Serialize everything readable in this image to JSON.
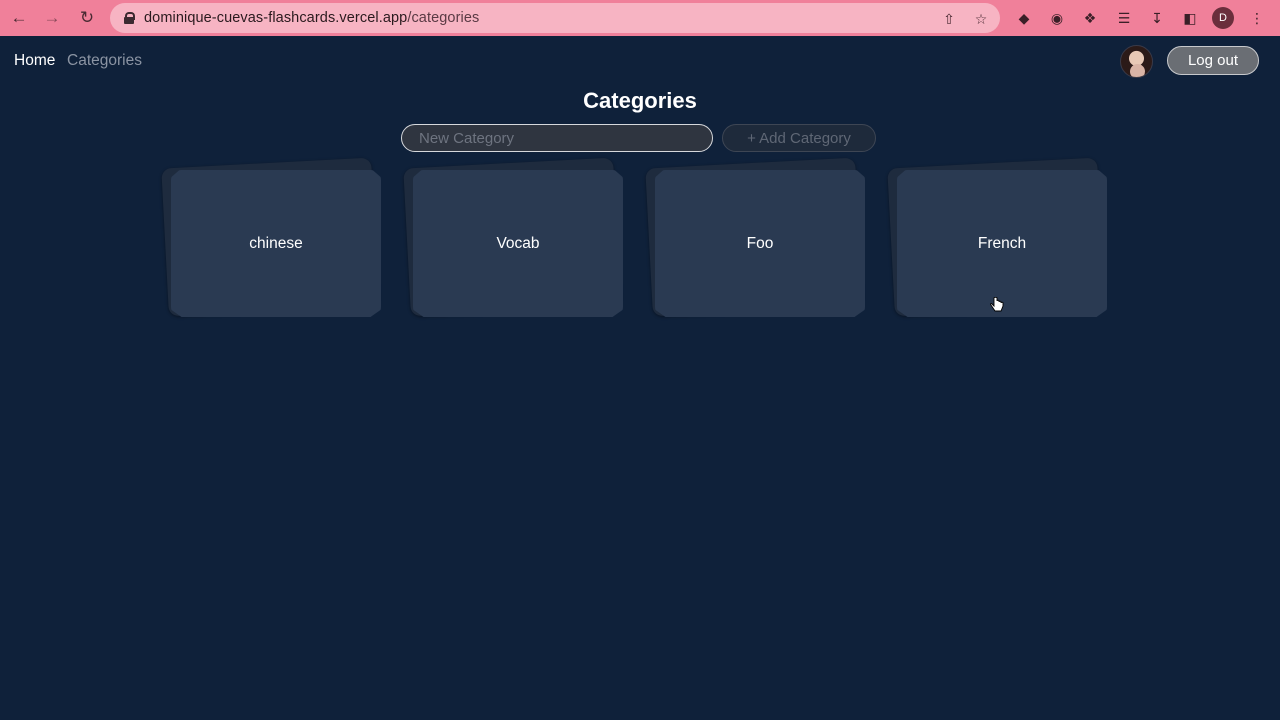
{
  "browser": {
    "url_host": "dominique-cuevas-flashcards.vercel.app",
    "url_path": "/categories",
    "profile_initial": "D",
    "chrome_color": "#f0809a"
  },
  "nav": {
    "home": "Home",
    "categories": "Categories",
    "logout": "Log out"
  },
  "page": {
    "title": "Categories",
    "input_placeholder": "New Category",
    "add_button": "+ Add Category"
  },
  "categories": [
    "chinese",
    "Vocab",
    "Foo",
    "French"
  ],
  "colors": {
    "background": "#0f213a",
    "card": "#2a3a52"
  }
}
